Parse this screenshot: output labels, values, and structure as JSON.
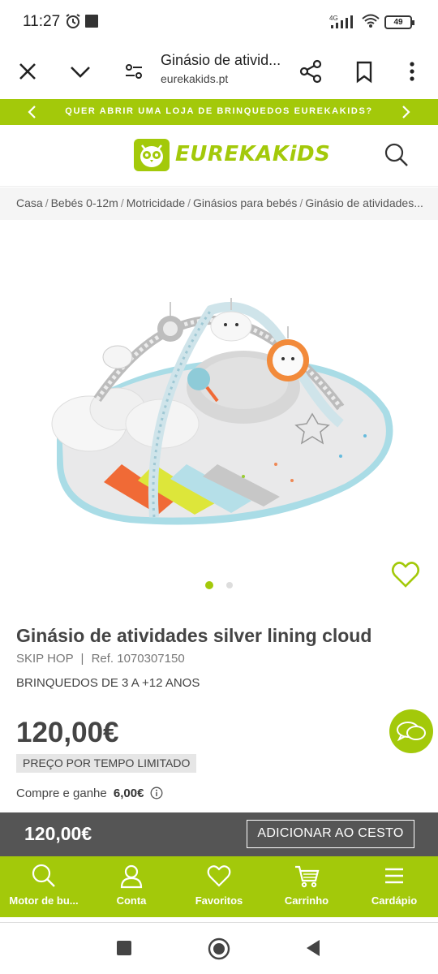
{
  "status_bar": {
    "time": "11:27",
    "network": "4G",
    "battery": "49"
  },
  "browser": {
    "page_title": "Ginásio de ativid...",
    "url": "eurekakids.pt"
  },
  "promo": {
    "text": "QUER ABRIR UMA LOJA DE BRINQUEDOS EUREKAKIDS?"
  },
  "header": {
    "logo_text": "EUREKAKiDS"
  },
  "breadcrumb": [
    "Casa",
    "Bebés 0-12m",
    "Motricidade",
    "Ginásios para bebés",
    "Ginásio de atividades..."
  ],
  "product": {
    "title": "Ginásio de atividades silver lining cloud",
    "brand": "SKIP HOP",
    "ref": "Ref. 1070307150",
    "age": "BRINQUEDOS DE 3 A +12 ANOS",
    "price": "120,00€",
    "limited_label": "PREÇO POR TEMPO LIMITADO",
    "earn_text": "Compre e ganhe",
    "earn_value": "6,00€",
    "gallery_dots": 2,
    "gallery_active": 0
  },
  "cart_bar": {
    "price": "120,00€",
    "button": "ADICIONAR AO CESTO"
  },
  "bottom_nav": [
    {
      "label": "Motor de bu...",
      "icon": "search-icon"
    },
    {
      "label": "Conta",
      "icon": "user-icon"
    },
    {
      "label": "Favoritos",
      "icon": "heart-icon"
    },
    {
      "label": "Carrinho",
      "icon": "cart-icon"
    },
    {
      "label": "Cardápio",
      "icon": "menu-icon"
    }
  ],
  "colors": {
    "brand_green": "#a3c90a",
    "bar_dark": "#555555"
  }
}
